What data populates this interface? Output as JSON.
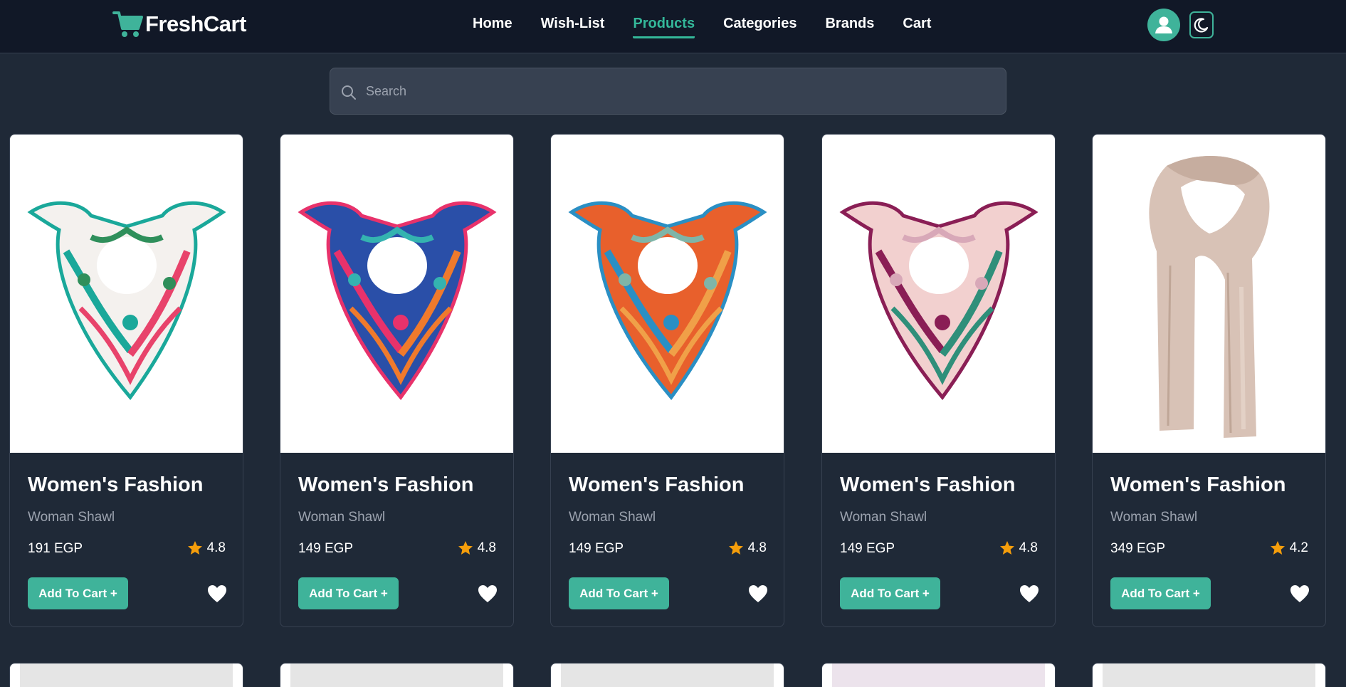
{
  "header": {
    "logo_text": "FreshCart",
    "nav": [
      "Home",
      "Wish-List",
      "Products",
      "Categories",
      "Brands",
      "Cart"
    ],
    "active_nav": "Products"
  },
  "search": {
    "placeholder": "Search"
  },
  "products": [
    {
      "title": "Women's Fashion",
      "subtitle": "Woman Shawl",
      "price": "191 EGP",
      "rating": "4.8",
      "button": "Add To Cart +",
      "scarf": {
        "base": "#f4f1ee",
        "accent1": "#1aa89a",
        "accent2": "#e8436b",
        "accent3": "#2f8f5b"
      }
    },
    {
      "title": "Women's Fashion",
      "subtitle": "Woman Shawl",
      "price": "149 EGP",
      "rating": "4.8",
      "button": "Add To Cart +",
      "scarf": {
        "base": "#2a4fa8",
        "accent1": "#e8326b",
        "accent2": "#f07a2c",
        "accent3": "#34b3b0"
      }
    },
    {
      "title": "Women's Fashion",
      "subtitle": "Woman Shawl",
      "price": "149 EGP",
      "rating": "4.8",
      "button": "Add To Cart +",
      "scarf": {
        "base": "#e8602c",
        "accent1": "#2a8fc4",
        "accent2": "#f0a048",
        "accent3": "#7fb5a8"
      }
    },
    {
      "title": "Women's Fashion",
      "subtitle": "Woman Shawl",
      "price": "149 EGP",
      "rating": "4.8",
      "button": "Add To Cart +",
      "scarf": {
        "base": "#f2d0cf",
        "accent1": "#8a1e55",
        "accent2": "#2f8f7a",
        "accent3": "#d8a8b8"
      }
    },
    {
      "title": "Women's Fashion",
      "subtitle": "Woman Shawl",
      "price": "349 EGP",
      "rating": "4.2",
      "button": "Add To Cart +",
      "scarf": {
        "base": "#d8c2b6",
        "accent1": "#c6ad9f",
        "accent2": "#e3d1c6",
        "accent3": "#bfa697"
      }
    }
  ],
  "colors": {
    "accent": "#3fb39a",
    "nav_bg": "#111827",
    "page_bg": "#1f2937",
    "star": "#f59e0b"
  }
}
